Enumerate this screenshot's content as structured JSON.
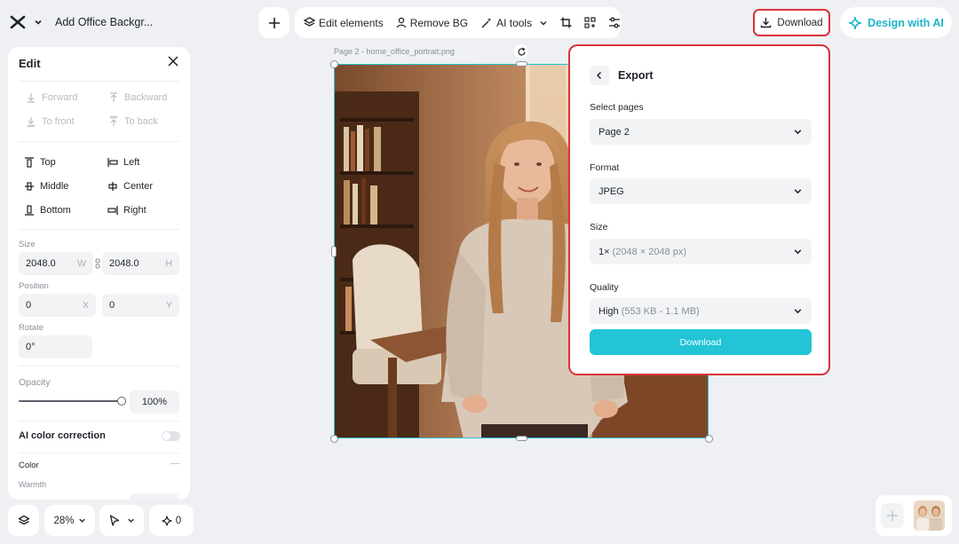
{
  "header": {
    "doc_title": "Add Office Backgr...",
    "toolbar": {
      "edit_elements": "Edit elements",
      "remove_bg": "Remove BG",
      "ai_tools": "AI tools"
    },
    "download_label": "Download",
    "design_ai_label": "Design with AI"
  },
  "edit_panel": {
    "title": "Edit",
    "layer_actions": [
      "Forward",
      "Backward",
      "To front",
      "To back"
    ],
    "align": {
      "top": "Top",
      "left": "Left",
      "middle": "Middle",
      "center": "Center",
      "bottom": "Bottom",
      "right": "Right"
    },
    "size": {
      "label": "Size",
      "w": "2048.0",
      "w_suffix": "W",
      "h": "2048.0",
      "h_suffix": "H"
    },
    "position": {
      "label": "Position",
      "x": "0",
      "x_suffix": "X",
      "y": "0",
      "y_suffix": "Y"
    },
    "rotate": {
      "label": "Rotate",
      "value": "0°"
    },
    "opacity": {
      "label": "Opacity",
      "value": "100%",
      "level": 1.0
    },
    "ai_color": {
      "label": "AI color correction",
      "enabled": false
    },
    "color": {
      "label": "Color",
      "dash": "—"
    },
    "warmth": {
      "label": "Warmth"
    }
  },
  "bottom_bar": {
    "zoom": "28%",
    "ai_count": "0"
  },
  "canvas": {
    "page_label": "Page 2 -  home_office_portrait.png"
  },
  "export": {
    "title": "Export",
    "pages_label": "Select pages",
    "pages_value": "Page 2",
    "format_label": "Format",
    "format_value": "JPEG",
    "size_label": "Size",
    "size_value": "1×",
    "size_detail": "(2048 × 2048 px)",
    "quality_label": "Quality",
    "quality_value": "High",
    "quality_detail": "(553 KB - 1.1 MB)",
    "download_label": "Download"
  },
  "colors": {
    "accent": "#22c4d6",
    "highlight_border": "#d93438",
    "background": "#eef0f3"
  }
}
